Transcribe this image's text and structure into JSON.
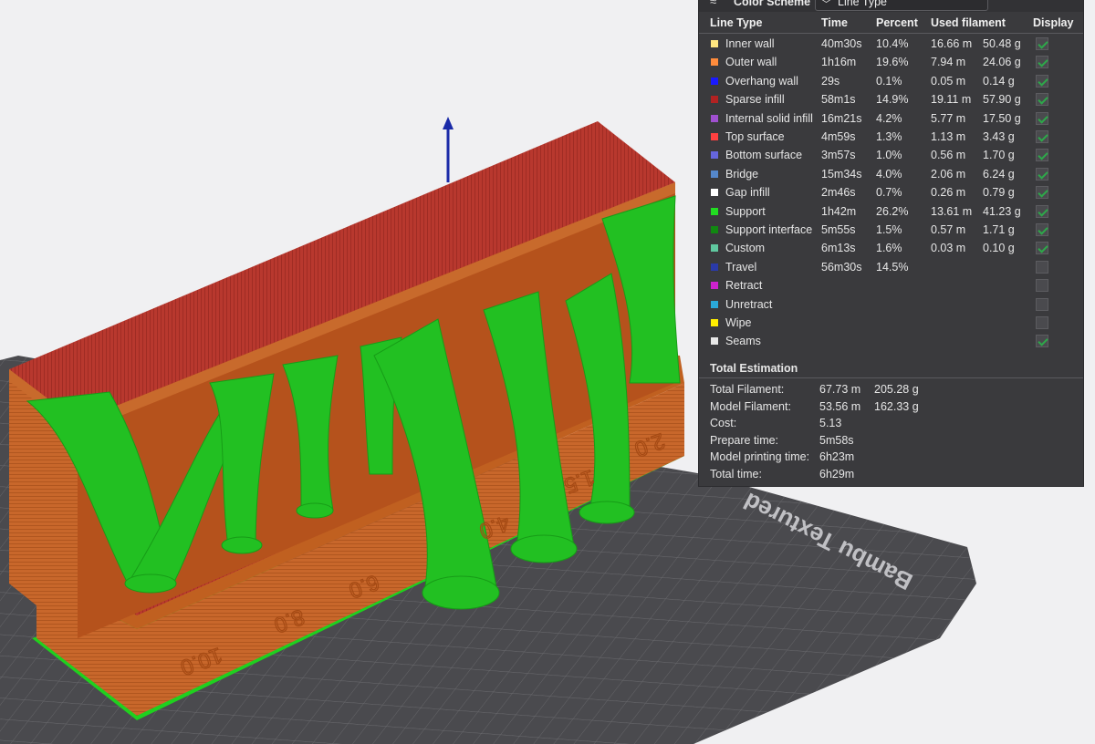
{
  "panel": {
    "collapse_glyph": "≈",
    "title": "Color Scheme",
    "dropdown_value": "Line Type",
    "headers": {
      "line_type": "Line Type",
      "time": "Time",
      "percent": "Percent",
      "used": "Used filament",
      "display": "Display"
    },
    "rows": [
      {
        "name": "Inner wall",
        "color": "#ffe680",
        "time": "40m30s",
        "percent": "10.4%",
        "length": "16.66 m",
        "weight": "50.48 g",
        "display": true
      },
      {
        "name": "Outer wall",
        "color": "#ff8c3c",
        "time": "1h16m",
        "percent": "19.6%",
        "length": "7.94 m",
        "weight": "24.06 g",
        "display": true
      },
      {
        "name": "Overhang wall",
        "color": "#1a1aff",
        "time": "29s",
        "percent": "0.1%",
        "length": "0.05 m",
        "weight": "0.14 g",
        "display": true
      },
      {
        "name": "Sparse infill",
        "color": "#b22222",
        "time": "58m1s",
        "percent": "14.9%",
        "length": "19.11 m",
        "weight": "57.90 g",
        "display": true
      },
      {
        "name": "Internal solid infill",
        "color": "#a050d0",
        "time": "16m21s",
        "percent": "4.2%",
        "length": "5.77 m",
        "weight": "17.50 g",
        "display": true
      },
      {
        "name": "Top surface",
        "color": "#ff4040",
        "time": "4m59s",
        "percent": "1.3%",
        "length": "1.13 m",
        "weight": "3.43 g",
        "display": true
      },
      {
        "name": "Bottom surface",
        "color": "#6666dd",
        "time": "3m57s",
        "percent": "1.0%",
        "length": "0.56 m",
        "weight": "1.70 g",
        "display": true
      },
      {
        "name": "Bridge",
        "color": "#5588cc",
        "time": "15m34s",
        "percent": "4.0%",
        "length": "2.06 m",
        "weight": "6.24 g",
        "display": true
      },
      {
        "name": "Gap infill",
        "color": "#ffffff",
        "time": "2m46s",
        "percent": "0.7%",
        "length": "0.26 m",
        "weight": "0.79 g",
        "display": true
      },
      {
        "name": "Support",
        "color": "#22dd22",
        "time": "1h42m",
        "percent": "26.2%",
        "length": "13.61 m",
        "weight": "41.23 g",
        "display": true
      },
      {
        "name": "Support interface",
        "color": "#118811",
        "time": "5m55s",
        "percent": "1.5%",
        "length": "0.57 m",
        "weight": "1.71 g",
        "display": true
      },
      {
        "name": "Custom",
        "color": "#60c8a0",
        "time": "6m13s",
        "percent": "1.6%",
        "length": "0.03 m",
        "weight": "0.10 g",
        "display": true
      },
      {
        "name": "Travel",
        "color": "#2a3aa8",
        "time": "56m30s",
        "percent": "14.5%",
        "length": "",
        "weight": "",
        "display": false
      },
      {
        "name": "Retract",
        "color": "#cc22cc",
        "time": "",
        "percent": "",
        "length": "",
        "weight": "",
        "display": false
      },
      {
        "name": "Unretract",
        "color": "#2aa8d8",
        "time": "",
        "percent": "",
        "length": "",
        "weight": "",
        "display": false
      },
      {
        "name": "Wipe",
        "color": "#ffee00",
        "time": "",
        "percent": "",
        "length": "",
        "weight": "",
        "display": false
      },
      {
        "name": "Seams",
        "color": "#e8e8e8",
        "time": "",
        "percent": "",
        "length": "",
        "weight": "",
        "display": true
      }
    ],
    "total_title": "Total Estimation",
    "totals": [
      {
        "label": "Total Filament:",
        "value": "67.73 m",
        "extra": "205.28 g"
      },
      {
        "label": "Model Filament:",
        "value": "53.56 m",
        "extra": "162.33 g"
      },
      {
        "label": "Cost:",
        "value": "5.13",
        "extra": ""
      },
      {
        "label": "Prepare time:",
        "value": "5m58s",
        "extra": ""
      },
      {
        "label": "Model printing time:",
        "value": "6h23m",
        "extra": ""
      },
      {
        "label": "Total time:",
        "value": "6h29m",
        "extra": ""
      }
    ]
  },
  "scene": {
    "plate_label": "Bambu Textured",
    "front_numbers": [
      "10.0",
      "8.0",
      "6.0",
      "4.0"
    ],
    "right_numbers": [
      "2.0",
      "1.5"
    ],
    "colors": {
      "background": "#f0f0f2",
      "plate": "#4a4a4e",
      "outer_wall": "#c8672b",
      "top_surface": "#b8382e",
      "support": "#22c022"
    }
  }
}
